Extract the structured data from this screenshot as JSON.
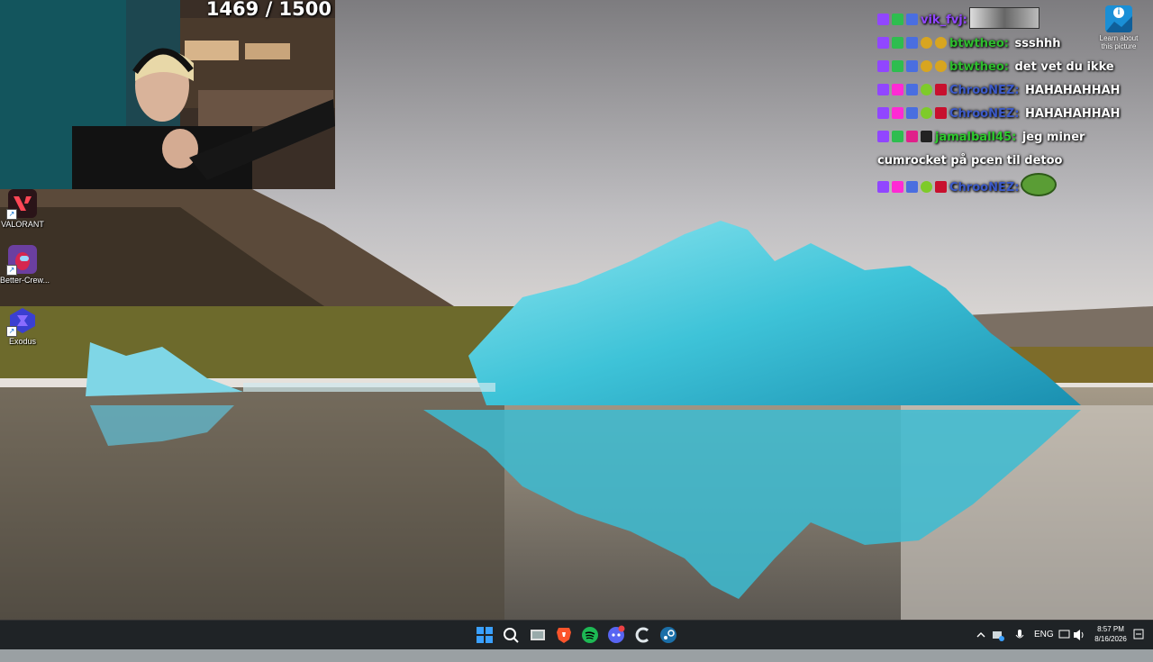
{
  "stream": {
    "counter": "1469 / 1500"
  },
  "desktop": {
    "icons": [
      {
        "label": "VALORANT",
        "icon": "valorant-icon",
        "color": "#ff4655"
      },
      {
        "label": "Better-Crew...",
        "icon": "better-crewlink-icon",
        "color": "#6b3fa0"
      },
      {
        "label": "Exodus",
        "icon": "exodus-icon",
        "color": "#3a3fd1"
      }
    ],
    "learn_label_line1": "Learn about",
    "learn_label_line2": "this picture"
  },
  "chat": {
    "messages": [
      {
        "user": "vik_fvj:",
        "user_color": "#9146ff",
        "text": ""
      },
      {
        "user": "btwtheo:",
        "user_color": "#2ebd2e",
        "text": "ssshhh"
      },
      {
        "user": "btwtheo:",
        "user_color": "#2ebd2e",
        "text": "det vet du ikke"
      },
      {
        "user": "ChrooNEZ:",
        "user_color": "#3c5ac8",
        "text": "HAHAHAHHAH"
      },
      {
        "user": "ChrooNEZ:",
        "user_color": "#3c5ac8",
        "text": "HAHAHAHHAH"
      },
      {
        "user": "jamalball45:",
        "user_color": "#2ecc2e",
        "text": "jeg miner cumrocket på pcen til detoo"
      },
      {
        "user": "ChrooNEZ:",
        "user_color": "#3c5ac8",
        "text": ""
      }
    ]
  },
  "taskbar": {
    "apps": [
      {
        "name": "start-button",
        "icon": "windows-logo-icon",
        "color": "#3aa0ff"
      },
      {
        "name": "search-button",
        "icon": "search-icon",
        "color": "#ffffff"
      },
      {
        "name": "task-view-button",
        "icon": "task-view-icon",
        "color": "#dddddd"
      },
      {
        "name": "brave-browser",
        "icon": "brave-icon",
        "color": "#fb542b"
      },
      {
        "name": "spotify",
        "icon": "spotify-icon",
        "color": "#1db954"
      },
      {
        "name": "discord",
        "icon": "discord-icon",
        "color": "#5865f2"
      },
      {
        "name": "ccleaner",
        "icon": "ccleaner-icon",
        "color": "#dfe6ea"
      },
      {
        "name": "steam",
        "icon": "steam-icon",
        "color": "#1b6fa8"
      }
    ],
    "tray": {
      "language": "ENG",
      "time": "8:57 PM",
      "date": "8/16/2026"
    }
  }
}
